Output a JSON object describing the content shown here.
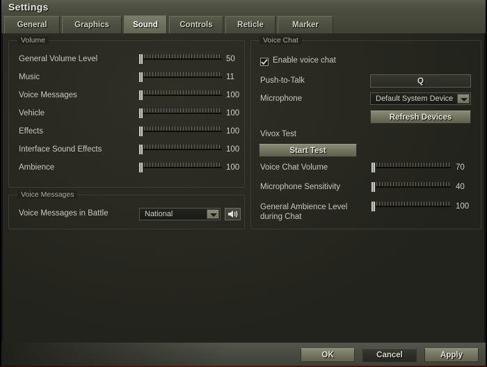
{
  "window": {
    "title": "Settings"
  },
  "tabs": [
    {
      "label": "General",
      "active": false
    },
    {
      "label": "Graphics",
      "active": false
    },
    {
      "label": "Sound",
      "active": true
    },
    {
      "label": "Controls",
      "active": false
    },
    {
      "label": "Reticle",
      "active": false
    },
    {
      "label": "Marker",
      "active": false
    }
  ],
  "volume_group": {
    "legend": "Volume",
    "sliders": [
      {
        "label": "General Volume Level",
        "value": "50",
        "percent": 50
      },
      {
        "label": "Music",
        "value": "11",
        "percent": 11
      },
      {
        "label": "Voice Messages",
        "value": "100",
        "percent": 100
      },
      {
        "label": "Vehicle",
        "value": "100",
        "percent": 100
      },
      {
        "label": "Effects",
        "value": "100",
        "percent": 100
      },
      {
        "label": "Interface Sound Effects",
        "value": "100",
        "percent": 100
      },
      {
        "label": "Ambience",
        "value": "100",
        "percent": 100
      }
    ]
  },
  "voice_messages_group": {
    "legend": "Voice Messages",
    "row_label": "Voice Messages in Battle",
    "dropdown_value": "National",
    "preview_icon": "speaker-icon"
  },
  "voice_chat_group": {
    "legend": "Voice Chat",
    "enable_label": "Enable voice chat",
    "enable_checked": true,
    "push_to_talk_label": "Push-to-Talk",
    "push_to_talk_key": "Q",
    "microphone_label": "Microphone",
    "microphone_value": "Default System Device",
    "refresh_label": "Refresh Devices",
    "vivox_label": "Vivox Test",
    "start_test_label": "Start Test",
    "sliders": [
      {
        "label": "Voice Chat Volume",
        "value": "70",
        "percent": 70
      },
      {
        "label": "Microphone Sensitivity",
        "value": "40",
        "percent": 40
      },
      {
        "label": "General Ambience Level during Chat",
        "value": "100",
        "percent": 100
      }
    ]
  },
  "footer": {
    "ok_label": "OK",
    "cancel_label": "Cancel",
    "apply_label": "Apply"
  },
  "colors": {
    "accent_red": "#b6432a",
    "panel_bg": "#23231d",
    "chrome": "#4e5142",
    "text": "#c8c8bd"
  }
}
